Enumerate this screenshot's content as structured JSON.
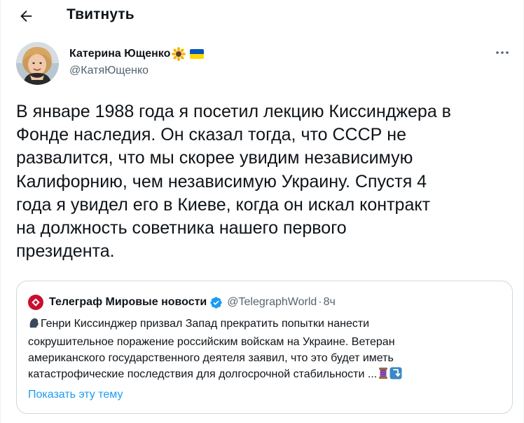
{
  "header": {
    "title": "Твитнуть"
  },
  "author": {
    "name": "Катерина Ющенко",
    "handle": "@КатяЮщенко",
    "flag_colors": [
      "#0057b7",
      "#ffd700"
    ]
  },
  "tweet": {
    "lines": [
      "В январе 1988 года я посетил лекцию Киссинджера в",
      "Фонде наследия. Он сказал тогда, что СССР не",
      "развалится, что мы скорее увидим независимую",
      "Калифорнию, чем независимую Украину. Спустя 4",
      "года я увидел его в Киеве, когда он искал контракт",
      "на должность советника нашего первого",
      "президента."
    ]
  },
  "quote": {
    "name": "Телеграф Мировые новости",
    "handle": "@TelegraphWorld",
    "separator": "·",
    "time": "8ч",
    "lines": [
      "Генри Киссинджер призвал Запад прекратить попытки нанести",
      "сокрушительное поражение российским войскам на Украине. Ветеран",
      "американского государственного деятеля заявил, что это будет иметь",
      "катастрофические последствия для долгосрочной стабильности ..."
    ],
    "show_thread": "Показать эту тему"
  },
  "icons": {
    "back": "arrow-left-icon",
    "more": "more-horizontal-icon",
    "verified": "verified-badge-icon",
    "speaking": "speaking-head-icon",
    "thread": "spool-of-thread-icon",
    "arrow_down": "arrow-turn-down-icon"
  },
  "colors": {
    "link": "#1d9bf0",
    "secondary_text": "#536471",
    "border": "#cfd9de",
    "telegraph_red": "#c8102e"
  }
}
